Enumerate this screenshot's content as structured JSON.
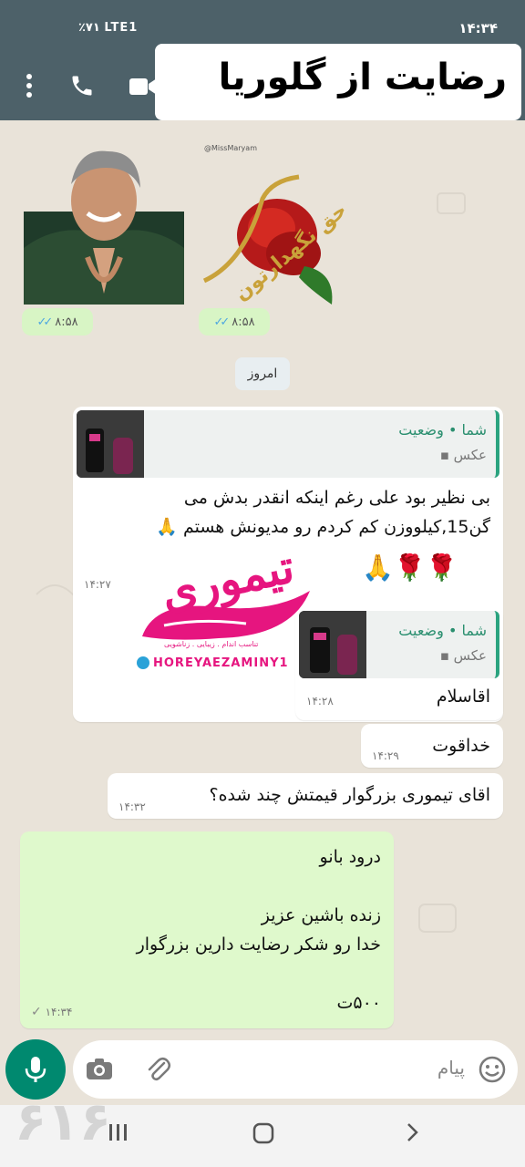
{
  "status_bar": {
    "time": "۱۴:۳۴",
    "left_text": "٪۷۱  LTE1"
  },
  "header": {
    "title_overlay": "رضایت از گلوریا",
    "icons": [
      "more-vert-icon",
      "phone-icon",
      "video-call-icon"
    ]
  },
  "stickers": [
    {
      "name": "rose-sticker",
      "caption": "حق نگهدارتون",
      "watermark": "@MissMaryam",
      "time": "۸:۵۸"
    },
    {
      "name": "thanks-sticker",
      "time": "۸:۵۸"
    }
  ],
  "date_chip": "امروز",
  "messages": [
    {
      "quote_name": "شما • وضعیت",
      "quote_type": "عکس",
      "text": "بی نظیر بود علی رغم اینکه انقدر بدش می\nگن15,کیلووزن کم کردم رو مدیونش هستم 🙏",
      "emojis": "🙏🌹🌹",
      "time": "۱۴:۲۷"
    },
    {
      "quote_name": "شما • وضعیت",
      "quote_type": "عکس",
      "text": "اقاسلام",
      "time": "۱۴:۲۸"
    },
    {
      "text": "خداقوت",
      "time": "۱۴:۲۹"
    },
    {
      "text": "اقای تیموری بزرگوار قیمتش چند شده؟",
      "time": "۱۴:۳۲"
    },
    {
      "outgoing": true,
      "text": "درود بانو\n\nزنده باشین عزیز\nخدا رو شکر رضایت دارین بزرگوار\n\n۵۰۰ت",
      "time": "۱۴:۳۴"
    }
  ],
  "watermark_logo": {
    "title": "تیموری",
    "tagline": "تناسب اندام . زیبایی . زناشویی",
    "handle": "HOREYAEZAMINY1"
  },
  "composer": {
    "placeholder": "پیام"
  },
  "corner_mark": "۶۱۶",
  "colors": {
    "header": "#4d6169",
    "accent": "#00896f",
    "outgoing_bubble": "#dff9cc",
    "chat_bg": "#e9e3d9",
    "logo_pink": "#e6157f"
  }
}
